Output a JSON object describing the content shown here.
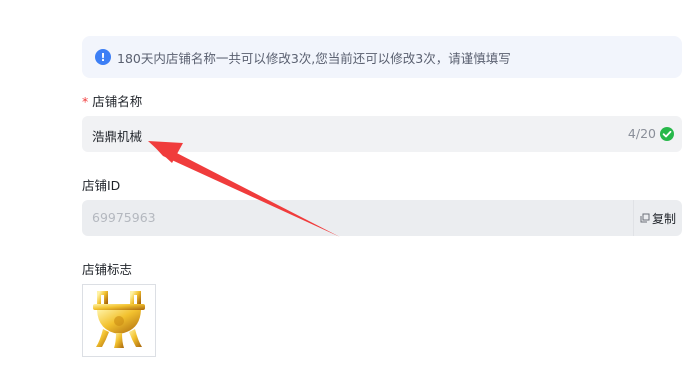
{
  "notice": {
    "icon": "info-icon",
    "icon_glyph": "!",
    "text": "180天内店铺名称一共可以修改3次,您当前还可以修改3次，请谨慎填写"
  },
  "store_name": {
    "required_mark": "*",
    "label": "店铺名称",
    "value": "浩鼎机械",
    "counter": "4/20",
    "status_icon": "check-circle-icon",
    "status_color": "#27b84a"
  },
  "store_id": {
    "label": "店铺ID",
    "value": "69975963",
    "copy_label": "复制",
    "copy_icon": "copy-icon"
  },
  "store_logo": {
    "label": "店铺标志",
    "image": "golden-tripod-ding-logo"
  },
  "annotation": {
    "type": "red-arrow",
    "color": "#f03c3c"
  }
}
